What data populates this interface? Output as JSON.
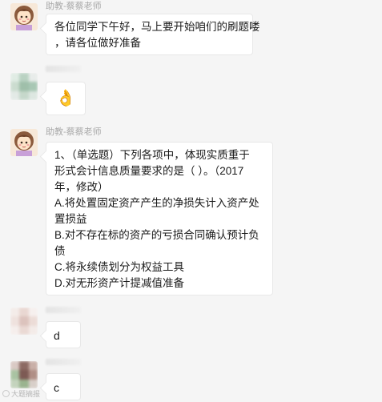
{
  "messages": [
    {
      "sender": "助教-蔡蔡老师",
      "avatar": "cartoon-girl-icon",
      "lines": [
        "各位同学下午好，马上要开始咱们的刷题喽",
        "，请各位做好准备"
      ]
    },
    {
      "sender": "",
      "avatar": "blurred-avatar",
      "emoji": "👌"
    },
    {
      "sender": "助教-蔡蔡老师",
      "avatar": "cartoon-girl-icon",
      "lines": [
        "1、（单选题）下列各项中，体现实质重于",
        "形式会计信息质量要求的是（  ）。（2017",
        "年，修改）",
        "A.将处置固定资产产生的净损失计入资产处",
        "置损益",
        "B.对不存在标的资产的亏损合同确认预计负",
        "债",
        "C.将永续债划分为权益工具",
        "D.对无形资产计提减值准备"
      ]
    },
    {
      "sender": "",
      "avatar": "blurred-avatar",
      "text": "d"
    },
    {
      "sender": "",
      "avatar": "blurred-avatar",
      "text": "c"
    }
  ],
  "watermark": "大题摘报",
  "colors": {
    "background": "#f5f5f5",
    "bubble": "#ffffff",
    "sender_text": "#a9a9a9"
  }
}
